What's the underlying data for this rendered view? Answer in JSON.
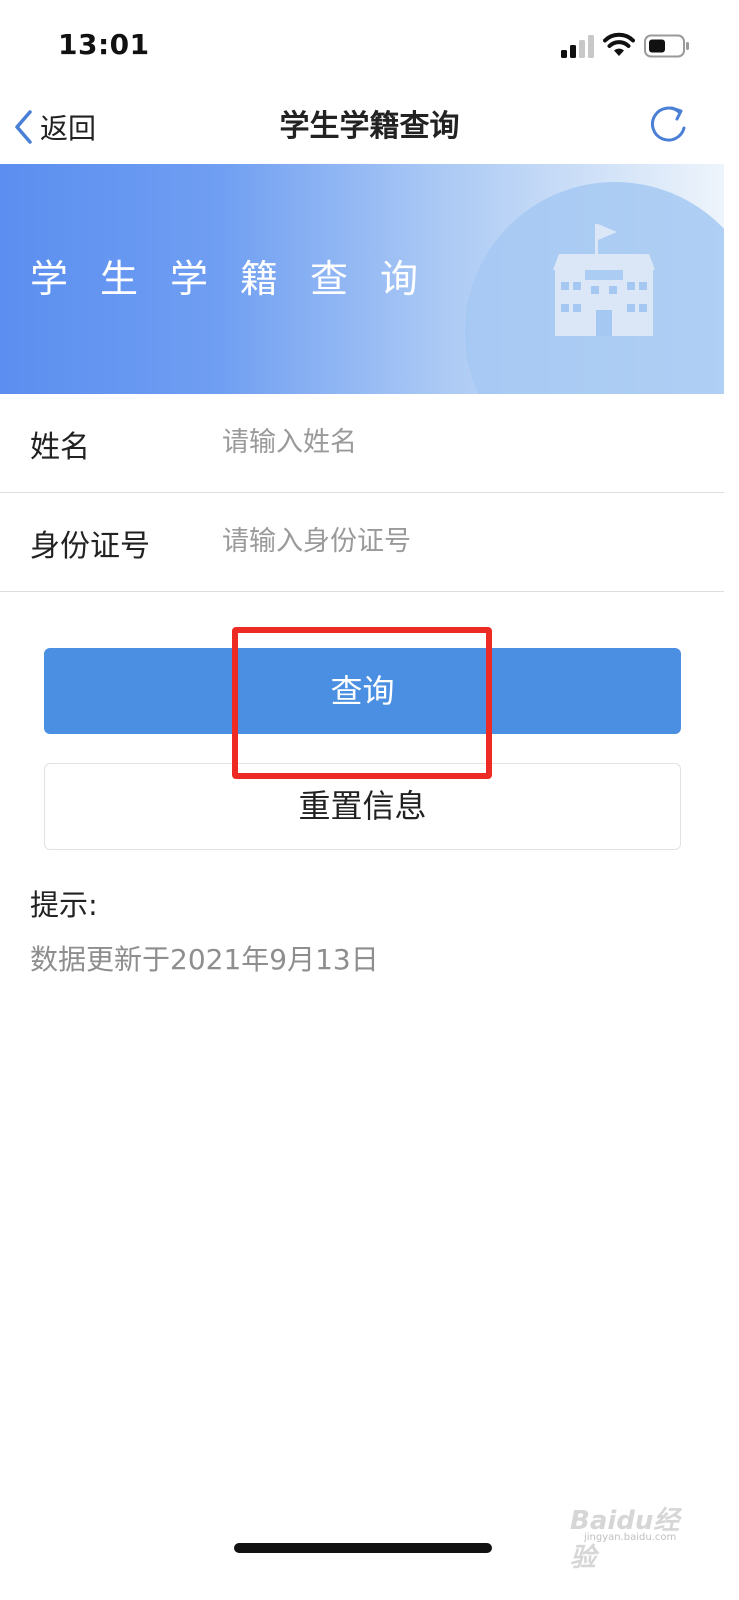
{
  "status_bar": {
    "time": "13:01"
  },
  "nav": {
    "back_label": "返回",
    "title": "学生学籍查询"
  },
  "banner": {
    "title": "学生学籍查询"
  },
  "form": {
    "name": {
      "label": "姓名",
      "placeholder": "请输入姓名",
      "value": ""
    },
    "id_number": {
      "label": "身份证号",
      "placeholder": "请输入身份证号",
      "value": ""
    }
  },
  "buttons": {
    "query_label": "查询",
    "reset_label": "重置信息"
  },
  "tips": {
    "title": "提示:",
    "text": "数据更新于2021年9月13日"
  },
  "watermark": {
    "brand": "Baidu经验",
    "url": "jingyan.baidu.com"
  },
  "colors": {
    "primary_button": "#4a8fe2",
    "highlight": "#ee2a24",
    "banner_start": "#5b8ef0",
    "banner_end": "#eef4fb"
  },
  "icons": {
    "back": "chevron-left-icon",
    "refresh": "refresh-icon",
    "school": "school-icon",
    "signal": "signal-icon",
    "wifi": "wifi-icon",
    "battery": "battery-icon"
  }
}
